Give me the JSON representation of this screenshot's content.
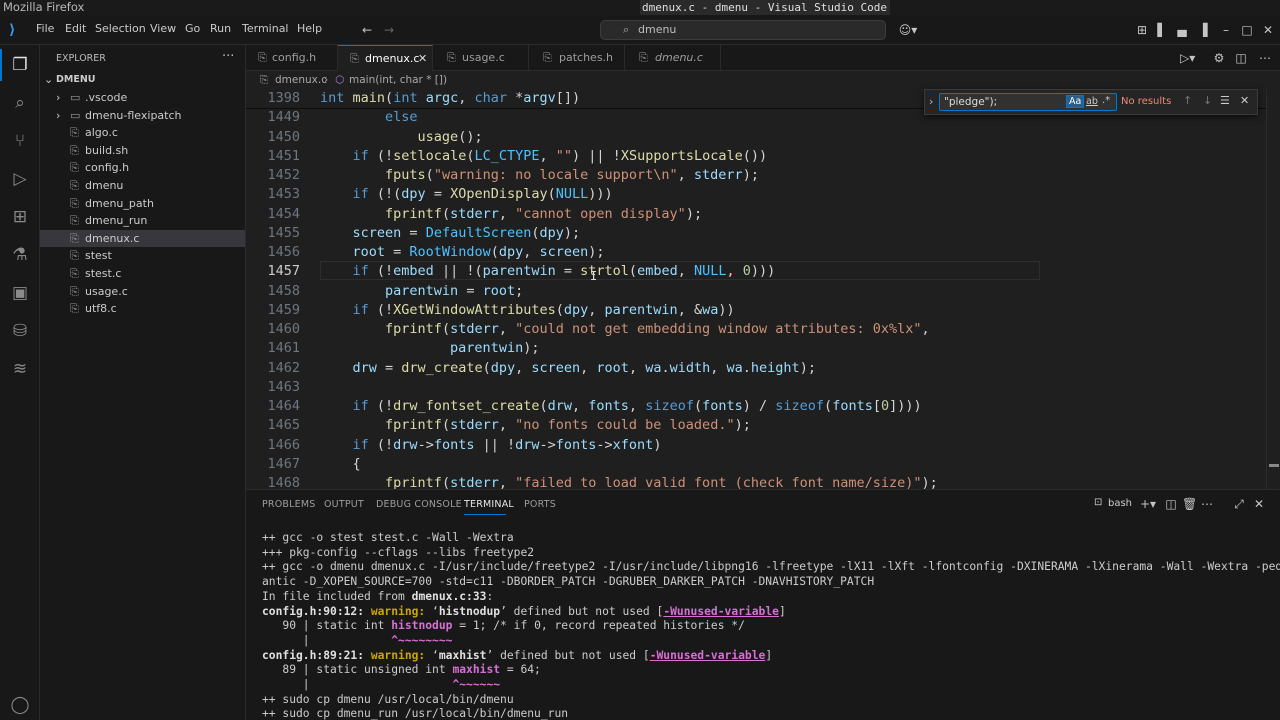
{
  "os_title": {
    "app": "Mozilla Firefox",
    "window": "dmenux.c - dmenu - Visual Studio Code"
  },
  "menu": [
    "File",
    "Edit",
    "Selection",
    "View",
    "Go",
    "Run",
    "Terminal",
    "Help"
  ],
  "search": {
    "placeholder": "dmenu"
  },
  "explorer": {
    "title": "EXPLORER",
    "root": "DMENU",
    "items": [
      {
        "label": ".vscode",
        "type": "folder"
      },
      {
        "label": "dmenu-flexipatch",
        "type": "folder"
      },
      {
        "label": "algo.c",
        "type": "file"
      },
      {
        "label": "build.sh",
        "type": "file"
      },
      {
        "label": "config.h",
        "type": "file"
      },
      {
        "label": "dmenu",
        "type": "file"
      },
      {
        "label": "dmenu_path",
        "type": "file"
      },
      {
        "label": "dmenu_run",
        "type": "file"
      },
      {
        "label": "dmenux.c",
        "type": "file",
        "selected": true
      },
      {
        "label": "stest",
        "type": "file"
      },
      {
        "label": "stest.c",
        "type": "file"
      },
      {
        "label": "usage.c",
        "type": "file"
      },
      {
        "label": "utf8.c",
        "type": "file"
      }
    ]
  },
  "tabs": [
    {
      "label": "config.h",
      "active": false
    },
    {
      "label": "dmenux.c",
      "active": true
    },
    {
      "label": "usage.c",
      "active": false
    },
    {
      "label": "patches.h",
      "active": false
    },
    {
      "label": "dmenu.c",
      "active": false,
      "italic": true
    }
  ],
  "breadcrumb": {
    "file": "dmenux.c",
    "symbol": "main(int, char * [])"
  },
  "find": {
    "value": "\"pledge\");",
    "status": "No results",
    "case": "Aa",
    "word": "ab",
    "regex": ".*"
  },
  "code": {
    "lines": [
      {
        "n": "1398",
        "html": "<span class='kw'>int</span> <span class='fn'>main</span>(<span class='kw'>int</span> <span class='var'>argc</span>, <span class='kw'>char</span> *<span class='var'>argv</span>[])"
      },
      {
        "n": "1449",
        "html": "        <span class='kw'>else</span>"
      },
      {
        "n": "1450",
        "html": "            <span class='fn'>usage</span>();"
      },
      {
        "n": "1451",
        "html": "    <span class='kw'>if</span> (!<span class='fn'>setlocale</span>(<span class='mac'>LC_CTYPE</span>, <span class='str'>\"\"</span>) || !<span class='fn'>XSupportsLocale</span>())"
      },
      {
        "n": "1452",
        "html": "        <span class='fn'>fputs</span>(<span class='str'>\"warning: no locale support\\n\"</span>, <span class='var'>stderr</span>);"
      },
      {
        "n": "1453",
        "html": "    <span class='kw'>if</span> (!(<span class='var'>dpy</span> = <span class='fn'>XOpenDisplay</span>(<span class='mac'>NULL</span>)))"
      },
      {
        "n": "1454",
        "html": "        <span class='fn'>fprintf</span>(<span class='var'>stderr</span>, <span class='str'>\"cannot open display\"</span>);"
      },
      {
        "n": "1455",
        "html": "    <span class='var'>screen</span> = <span class='mac'>DefaultScreen</span>(<span class='var'>dpy</span>);"
      },
      {
        "n": "1456",
        "html": "    <span class='var'>root</span> = <span class='mac'>RootWindow</span>(<span class='var'>dpy</span>, <span class='var'>screen</span>);"
      },
      {
        "n": "1457",
        "html": "    <span class='kw'>if</span> (!<span class='var'>embed</span> || !(<span class='var'>parentwin</span> = <span class='fn'>strtol</span>(<span class='var'>embed</span>, <span class='mac'>NULL</span>, <span class='num'>0</span>)))"
      },
      {
        "n": "1458",
        "html": "        <span class='var'>parentwin</span> = <span class='var'>root</span>;"
      },
      {
        "n": "1459",
        "html": "    <span class='kw'>if</span> (!<span class='fn'>XGetWindowAttributes</span>(<span class='var'>dpy</span>, <span class='var'>parentwin</span>, &amp;<span class='var'>wa</span>))"
      },
      {
        "n": "1460",
        "html": "        <span class='fn'>fprintf</span>(<span class='var'>stderr</span>, <span class='str'>\"could not get embedding window attributes: 0x%lx\"</span>,"
      },
      {
        "n": "1461",
        "html": "                <span class='var'>parentwin</span>);"
      },
      {
        "n": "1462",
        "html": "    <span class='var'>drw</span> = <span class='fn'>drw_create</span>(<span class='var'>dpy</span>, <span class='var'>screen</span>, <span class='var'>root</span>, <span class='var'>wa</span>.<span class='var'>width</span>, <span class='var'>wa</span>.<span class='var'>height</span>);"
      },
      {
        "n": "1463",
        "html": ""
      },
      {
        "n": "1464",
        "html": "    <span class='kw'>if</span> (!<span class='fn'>drw_fontset_create</span>(<span class='var'>drw</span>, <span class='var'>fonts</span>, <span class='kw'>sizeof</span>(<span class='var'>fonts</span>) / <span class='kw'>sizeof</span>(<span class='var'>fonts</span>[<span class='num'>0</span>])))"
      },
      {
        "n": "1465",
        "html": "        <span class='fn'>fprintf</span>(<span class='var'>stderr</span>, <span class='str'>\"no fonts could be loaded.\"</span>);"
      },
      {
        "n": "1466",
        "html": "    <span class='kw'>if</span> (!<span class='var'>drw</span>-&gt;<span class='var'>fonts</span> || !<span class='var'>drw</span>-&gt;<span class='var'>fonts</span>-&gt;<span class='var'>xfont</span>)"
      },
      {
        "n": "1467",
        "html": "    {"
      },
      {
        "n": "1468",
        "html": "        <span class='fn'>fprintf</span>(<span class='var'>stderr</span>, <span class='str'>\"failed to load valid font (check font name/size)\"</span>);"
      }
    ]
  },
  "panel": {
    "tabs": [
      "PROBLEMS",
      "OUTPUT",
      "DEBUG CONSOLE",
      "TERMINAL",
      "PORTS"
    ],
    "active": "TERMINAL",
    "shell": "bash"
  },
  "terminal": [
    "++ gcc -o stest stest.c -Wall -Wextra",
    "+++ pkg-config --cflags --libs freetype2",
    "++ gcc -o dmenu dmenux.c -I/usr/include/freetype2 -I/usr/include/libpng16 -lfreetype -lX11 -lXft -lfontconfig -DXINERAMA -lXinerama -Wall -Wextra -ped",
    "antic -D_XOPEN_SOURCE=700 -std=c11 -DBORDER_PATCH -DGRUBER_DARKER_PATCH -DNAVHISTORY_PATCH",
    "<span>In file included from </span><span class='bold'>dmenux.c:33</span>:",
    "<span class='bold'>config.h:90:12: </span><span class='warn'>warning: </span>‘<span class='bold'>histnodup</span>’ defined but not used [<span class='under'>-Wunused-variable</span>]",
    "   90 | static int <span class='mag'>histnodup</span> = 1; /* if 0, record repeated histories */",
    "      |            <span class='mag'>^~~~~~~~~</span>",
    "<span class='bold'>config.h:89:21: </span><span class='warn'>warning: </span>‘<span class='bold'>maxhist</span>’ defined but not used [<span class='under'>-Wunused-variable</span>]",
    "   89 | static unsigned int <span class='mag'>maxhist</span> = 64;",
    "      |                     <span class='mag'>^~~~~~~</span>",
    "++ sudo cp dmenu /usr/local/bin/dmenu",
    "++ sudo cp dmenu_run /usr/local/bin/dmenu_run"
  ]
}
